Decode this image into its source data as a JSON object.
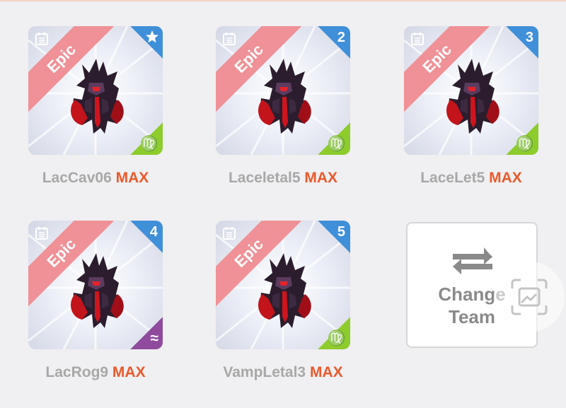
{
  "team": [
    {
      "rarity": "Epic",
      "corner": "star",
      "sign_color": "green",
      "sign": "♍",
      "name": "LacCav06",
      "max_label": "MAX"
    },
    {
      "rarity": "Epic",
      "corner": "2",
      "sign_color": "green",
      "sign": "♍",
      "name": "Laceletal5",
      "max_label": "MAX"
    },
    {
      "rarity": "Epic",
      "corner": "3",
      "sign_color": "green",
      "sign": "♍",
      "name": "LaceLet5",
      "max_label": "MAX"
    },
    {
      "rarity": "Epic",
      "corner": "4",
      "sign_color": "purple",
      "sign": "≈",
      "name": "LacRog9",
      "max_label": "MAX"
    },
    {
      "rarity": "Epic",
      "corner": "5",
      "sign_color": "green",
      "sign": "♍",
      "name": "VampLetal3",
      "max_label": "MAX"
    }
  ],
  "change_team": {
    "line1": "Change",
    "line2": "Team"
  },
  "icons": {
    "corner_star": "star-icon",
    "card_type": "calendar-icon",
    "swap": "swap-arrows-icon",
    "overlay": "screenshot-icon"
  },
  "colors": {
    "epic_ribbon": "#ef9196",
    "corner_blue": "#3f8fd9",
    "virgo_green": "#8dcc2c",
    "aquarius_purple": "#8f4a9e",
    "max_orange": "#e85a2c"
  }
}
